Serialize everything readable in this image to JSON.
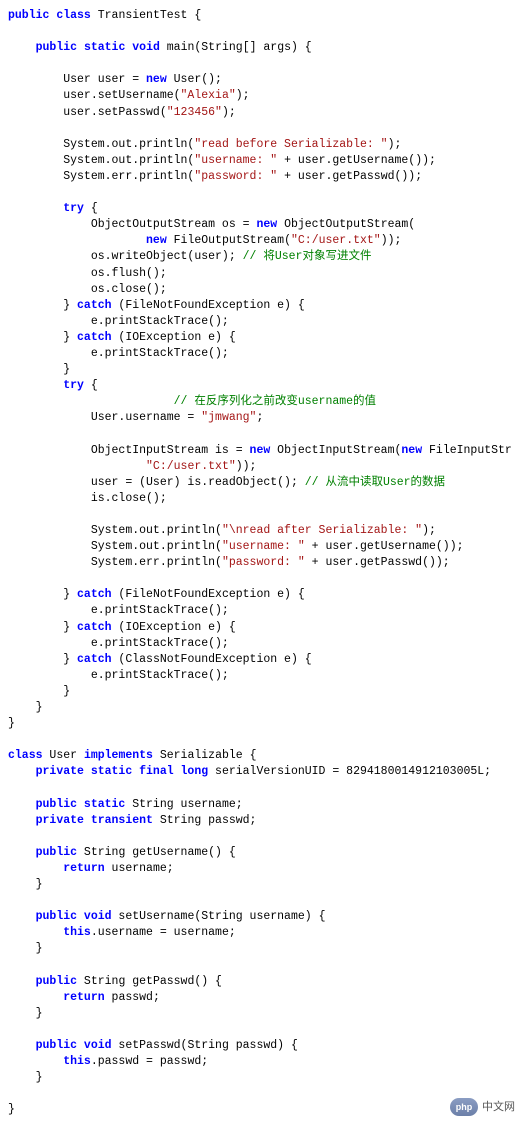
{
  "code": {
    "l1": "public class TransientTest {",
    "l2": "",
    "l3": "    public static void main(String[] args) {",
    "l4": "",
    "l5": "        User user = new User();",
    "l6_a": "        user.setUsername(",
    "l6_str": "\"Alexia\"",
    "l6_b": ");",
    "l7_a": "        user.setPasswd(",
    "l7_str": "\"123456\"",
    "l7_b": ");",
    "l8": "",
    "l9_a": "        System.out.println(",
    "l9_str": "\"read before Serializable: \"",
    "l9_b": ");",
    "l10_a": "        System.out.println(",
    "l10_str": "\"username: \"",
    "l10_b": " + user.getUsername());",
    "l11_a": "        System.err.println(",
    "l11_str": "\"password: \"",
    "l11_b": " + user.getPasswd());",
    "l12": "",
    "l13": "        try {",
    "l14_a": "            ObjectOutputStream os = ",
    "l14_new": "new",
    "l14_b": " ObjectOutputStream(",
    "l15_a": "                    ",
    "l15_new": "new",
    "l15_b": " FileOutputStream(",
    "l15_str": "\"C:/user.txt\"",
    "l15_c": "));",
    "l16_a": "            os.writeObject(user); ",
    "l16_cmt": "// 将User对象写进文件",
    "l17": "            os.flush();",
    "l18": "            os.close();",
    "l19_a": "        } ",
    "l19_catch": "catch",
    "l19_b": " (FileNotFoundException e) {",
    "l20": "            e.printStackTrace();",
    "l21_a": "        } ",
    "l21_catch": "catch",
    "l21_b": " (IOException e) {",
    "l22": "            e.printStackTrace();",
    "l23": "        }",
    "l24": "        try {",
    "l25": "            // 在反序列化之前改变username的值",
    "l26_a": "            User.username = ",
    "l26_str": "\"jmwang\"",
    "l26_b": ";",
    "l27": "",
    "l28_a": "            ObjectInputStream is = ",
    "l28_new": "new",
    "l28_b": " ObjectInputStream(",
    "l28_new2": "new",
    "l28_c": " FileInputStr",
    "l29_a": "                    ",
    "l29_str": "\"C:/user.txt\"",
    "l29_b": "));",
    "l30_a": "            user = (User) is.readObject(); ",
    "l30_cmt": "// 从流中读取User的数据",
    "l31": "            is.close();",
    "l32": "",
    "l33_a": "            System.out.println(",
    "l33_str": "\"\\nread after Serializable: \"",
    "l33_b": ");",
    "l34_a": "            System.out.println(",
    "l34_str": "\"username: \"",
    "l34_b": " + user.getUsername());",
    "l35_a": "            System.err.println(",
    "l35_str": "\"password: \"",
    "l35_b": " + user.getPasswd());",
    "l36": "",
    "l37_a": "        } ",
    "l37_catch": "catch",
    "l37_b": " (FileNotFoundException e) {",
    "l38": "            e.printStackTrace();",
    "l39_a": "        } ",
    "l39_catch": "catch",
    "l39_b": " (IOException e) {",
    "l40": "            e.printStackTrace();",
    "l41_a": "        } ",
    "l41_catch": "catch",
    "l41_b": " (ClassNotFoundException e) {",
    "l42": "            e.printStackTrace();",
    "l43": "        }",
    "l44": "    }",
    "l45": "}",
    "l46": "",
    "l47": "class User implements Serializable {",
    "l48_a": "    ",
    "l48_mod": "private static final long",
    "l48_b": " serialVersionUID = 8294180014912103005L;",
    "l49": "",
    "l50_a": "    ",
    "l50_mod": "public static",
    "l50_b": " String username;",
    "l51_a": "    ",
    "l51_mod": "private transient",
    "l51_b": " String passwd;",
    "l52": "",
    "l53_a": "    ",
    "l53_mod": "public",
    "l53_b": " String getUsername() {",
    "l54_a": "        ",
    "l54_ret": "return",
    "l54_b": " username;",
    "l55": "    }",
    "l56": "",
    "l57_a": "    ",
    "l57_mod": "public void",
    "l57_b": " setUsername(String username) {",
    "l58_a": "        ",
    "l58_this": "this",
    "l58_b": ".username = username;",
    "l59": "    }",
    "l60": "",
    "l61_a": "    ",
    "l61_mod": "public",
    "l61_b": " String getPasswd() {",
    "l62_a": "        ",
    "l62_ret": "return",
    "l62_b": " passwd;",
    "l63": "    }",
    "l64": "",
    "l65_a": "    ",
    "l65_mod": "public void",
    "l65_b": " setPasswd(String passwd) {",
    "l66_a": "        ",
    "l66_this": "this",
    "l66_b": ".passwd = passwd;",
    "l67": "    }",
    "l68": "",
    "l69": "}",
    "kw_public": "public",
    "kw_class": "class",
    "kw_static": "static",
    "kw_void": "void",
    "kw_new": "new",
    "kw_try": "try",
    "kw_implements": "implements",
    "label_TransientTest": " TransientTest {",
    "label_main_a": " main(String[] args) {",
    "label_user_decl": "        User user = ",
    "label_user_decl_b": " User();",
    "label_user_class": " User ",
    "label_serializable": " Serializable {"
  },
  "logo": {
    "badge": "php",
    "text": "中文网"
  }
}
